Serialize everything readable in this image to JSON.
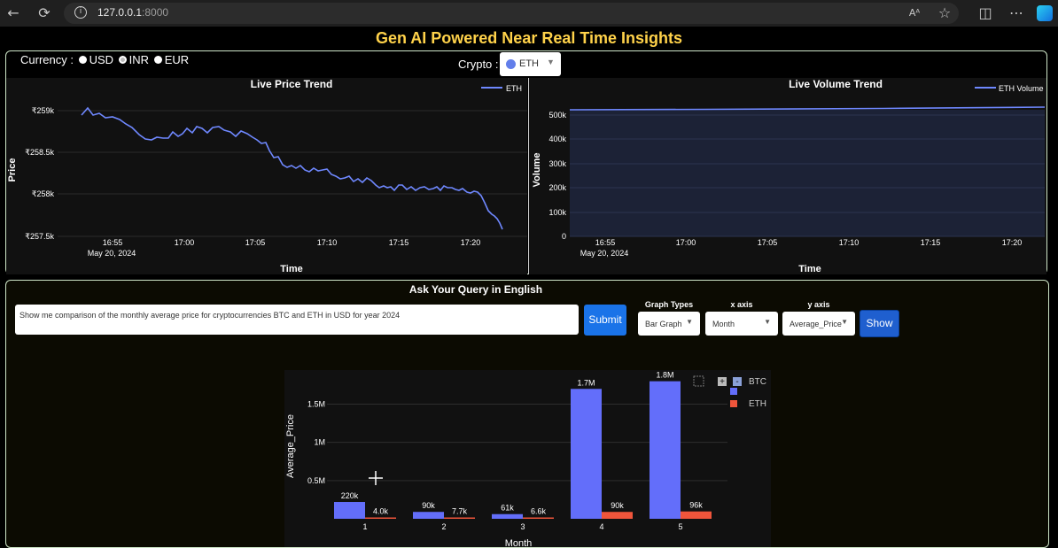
{
  "browser": {
    "url_host": "127.0.0.1",
    "url_port": ":8000",
    "reader_icon": "Aᴬ"
  },
  "app": {
    "title": "Gen AI Powered Near Real Time Insights"
  },
  "controls": {
    "currency_label": "Currency :",
    "currency_options": [
      "USD",
      "INR",
      "EUR"
    ],
    "currency_selected": "INR",
    "crypto_label": "Crypto :",
    "crypto_value": "ETH"
  },
  "price_chart": {
    "title": "Live Price Trend",
    "ylabel": "Price",
    "xlabel": "Time",
    "legend": "ETH",
    "yticks": [
      "₹259k",
      "₹258.5k",
      "₹258k",
      "₹257.5k"
    ],
    "xticks": [
      "16:55",
      "17:00",
      "17:05",
      "17:10",
      "17:15",
      "17:20"
    ],
    "date_label": "May 20, 2024",
    "line_color": "#6f88ff"
  },
  "volume_chart": {
    "title": "Live Volume Trend",
    "ylabel": "Volume",
    "xlabel": "Time",
    "legend": "ETH Volume",
    "yticks": [
      "500k",
      "400k",
      "300k",
      "200k",
      "100k",
      "0"
    ],
    "xticks": [
      "16:55",
      "17:00",
      "17:05",
      "17:10",
      "17:15",
      "17:20"
    ],
    "date_label": "May 20, 2024"
  },
  "query": {
    "title": "Ask Your Query in English",
    "text": "Show me comparison of the monthly average price for cryptocurrencies BTC and ETH in USD for year 2024",
    "submit_label": "Submit",
    "graph_types_label": "Graph Types",
    "graph_type_value": "Bar Graph",
    "x_axis_label": "x axis",
    "x_axis_value": "Month",
    "y_axis_label": "y axis",
    "y_axis_value": "Average_Price",
    "show_label": "Show"
  },
  "chart_data": {
    "type": "bar",
    "xlabel": "Month",
    "ylabel": "Average_Price",
    "categories": [
      "1",
      "2",
      "3",
      "4",
      "5"
    ],
    "series": [
      {
        "name": "BTC",
        "color": "#636efa",
        "values": [
          220000,
          90000,
          61000,
          1700000,
          1800000
        ],
        "labels": [
          "220k",
          "90k",
          "61k",
          "1.7M",
          "1.8M"
        ]
      },
      {
        "name": "ETH",
        "color": "#ef553b",
        "values": [
          4000,
          7700,
          6600,
          90000,
          96000
        ],
        "labels": [
          "4.0k",
          "7.7k",
          "6.6k",
          "90k",
          "96k"
        ]
      }
    ],
    "yticks": [
      "0.5M",
      "1M",
      "1.5M"
    ],
    "ylim": [
      0,
      1900000
    ],
    "legend_position": "top-right",
    "grid": true
  }
}
